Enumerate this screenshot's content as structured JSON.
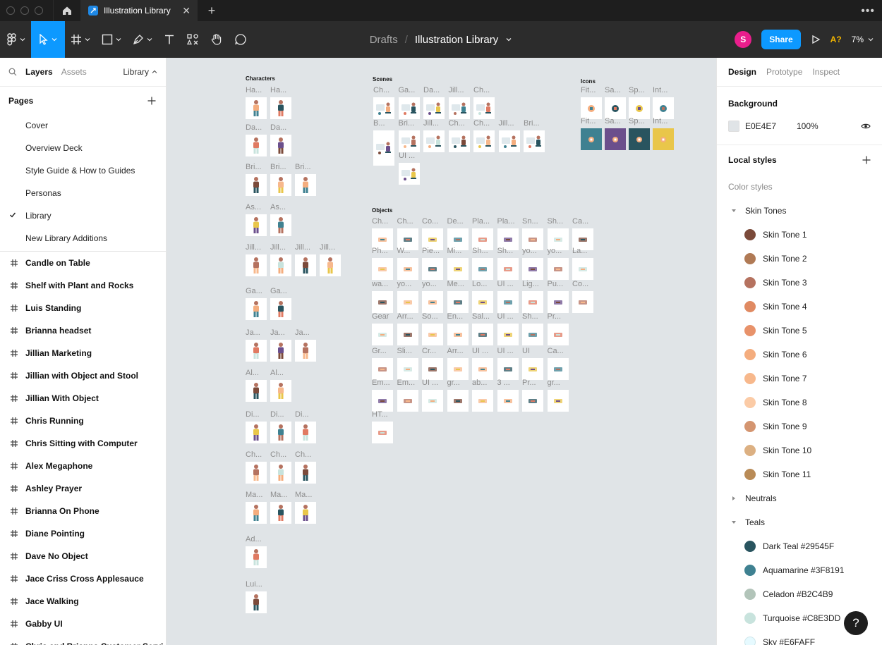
{
  "titlebar": {
    "tab_title": "Illustration Library",
    "close_glyph": "✕",
    "new_tab_glyph": "+",
    "more_glyph": "•••"
  },
  "toolbar": {
    "breadcrumb_drafts": "Drafts",
    "breadcrumb_sep": "/",
    "file_name": "Illustration Library",
    "avatar_letter": "S",
    "share_label": "Share",
    "a11y_label": "A?",
    "zoom_label": "7%"
  },
  "left_panel": {
    "tabs": [
      "Layers",
      "Assets"
    ],
    "library_label": "Library",
    "pages_heading": "Pages",
    "pages": [
      {
        "label": "Cover",
        "current": false
      },
      {
        "label": "Overview Deck",
        "current": false
      },
      {
        "label": "Style Guide & How to Guides",
        "current": false
      },
      {
        "label": "Personas",
        "current": false
      },
      {
        "label": "Library",
        "current": true
      },
      {
        "label": "New Library Additions",
        "current": false
      }
    ],
    "layers": [
      "Candle on Table",
      "Shelf with Plant and Rocks",
      "Luis Standing",
      "Brianna headset",
      "Jillian Marketing",
      "Jillian with Object and Stool",
      "Jillian With Object",
      "Chris Running",
      "Chris Sitting with Computer",
      "Alex Megaphone",
      "Ashley Prayer",
      "Brianna On Phone",
      "Diane Pointing",
      "Dave No Object",
      "Jace Criss Cross Applesauce",
      "Jace Walking",
      "Gabby UI",
      "Chris and Brianna Customer Servi..."
    ]
  },
  "canvas": {
    "sections": {
      "characters": "Characters",
      "scenes": "Scenes",
      "icons": "Icons",
      "objects": "Objects"
    },
    "characters_rows": [
      [
        "Ha...",
        "Ha..."
      ],
      [
        "Da...",
        "Da..."
      ],
      [
        "Bri...",
        "Bri...",
        "Bri..."
      ],
      [
        "As...",
        "As..."
      ],
      [
        "Jill...",
        "Jill...",
        "Jill...",
        "Jill..."
      ],
      [
        "Ga...",
        "Ga..."
      ],
      [
        "Ja...",
        "Ja...",
        "Ja..."
      ],
      [
        "Al...",
        "Al..."
      ],
      [
        "Di...",
        "Di...",
        "Di..."
      ],
      [
        "Ch...",
        "Ch...",
        "Ch..."
      ],
      [
        "Ma...",
        "Ma...",
        "Ma..."
      ],
      [
        "Ad..."
      ],
      [
        "Lui..."
      ]
    ],
    "scenes_row1": [
      "Ch...",
      "Ga...",
      "Da...",
      "Jill...",
      "Ch..."
    ],
    "scenes_row2": [
      "B...",
      "Bri...",
      "Jill...",
      "Ch...",
      "Ch...",
      "Jill...",
      "Bri..."
    ],
    "scenes_row3": [
      "UI ..."
    ],
    "icons_row1": [
      "Fit...",
      "Sa...",
      "Sp...",
      "Int..."
    ],
    "icons_row2": [
      "Fit...",
      "Sa...",
      "Sp...",
      "Int..."
    ],
    "objects_rows": [
      [
        "Ch...",
        "Ch...",
        "Co...",
        "De...",
        "Pla...",
        "Pla...",
        "Sn...",
        "Sh...",
        "Ca..."
      ],
      [
        "Ph...",
        "W...",
        "Pie...",
        "Mi...",
        "Sh...",
        "Sh...",
        "yo...",
        "yo...",
        "La..."
      ],
      [
        "wa...",
        "yo...",
        "yo...",
        "Me...",
        "Lo...",
        "UI ...",
        "Lig...",
        "Pu...",
        "Co..."
      ],
      [
        "Gear",
        "Arr...",
        "So...",
        "En...",
        "Sal...",
        "UI ...",
        "Sh...",
        "Pr..."
      ],
      [
        "Gr...",
        "Sli...",
        "Cr...",
        "Arr...",
        "UI ...",
        "UI ...",
        "UI",
        "Ca..."
      ],
      [
        "Em...",
        "Em...",
        "UI ...",
        "gr...",
        "ab...",
        "3 ...",
        "Pr...",
        "gr..."
      ],
      [
        "HT..."
      ]
    ]
  },
  "right_panel": {
    "tabs": [
      "Design",
      "Prototype",
      "Inspect"
    ],
    "background_heading": "Background",
    "background_hex": "E0E4E7",
    "background_opacity": "100%",
    "local_styles_heading": "Local styles",
    "color_styles_label": "Color styles",
    "groups": [
      {
        "name": "Skin Tones",
        "expanded": true,
        "styles": [
          {
            "name": "Skin Tone 1",
            "color": "#7b4a3a"
          },
          {
            "name": "Skin Tone 2",
            "color": "#b07a55"
          },
          {
            "name": "Skin Tone 3",
            "color": "#b5725f"
          },
          {
            "name": "Skin Tone 4",
            "color": "#e08a62"
          },
          {
            "name": "Skin Tone 5",
            "color": "#e8926a"
          },
          {
            "name": "Skin Tone 6",
            "color": "#f4ad7e"
          },
          {
            "name": "Skin Tone 7",
            "color": "#f7b88c"
          },
          {
            "name": "Skin Tone 8",
            "color": "#fbcba6"
          },
          {
            "name": "Skin Tone 9",
            "color": "#d49570"
          },
          {
            "name": "Skin Tone 10",
            "color": "#dcb082"
          },
          {
            "name": "Skin Tone 11",
            "color": "#b98b57"
          }
        ]
      },
      {
        "name": "Neutrals",
        "expanded": false,
        "styles": []
      },
      {
        "name": "Teals",
        "expanded": true,
        "styles": [
          {
            "name": "Dark Teal #29545F",
            "color": "#29545F"
          },
          {
            "name": "Aquamarine #3F8191",
            "color": "#3F8191"
          },
          {
            "name": "Celadon #B2C4B9",
            "color": "#B2C4B9"
          },
          {
            "name": "Turquoise #C8E3DD",
            "color": "#C8E3DD"
          },
          {
            "name": "Sky #E6FAFF",
            "color": "#E6FAFF"
          }
        ]
      }
    ]
  },
  "help_label": "?"
}
